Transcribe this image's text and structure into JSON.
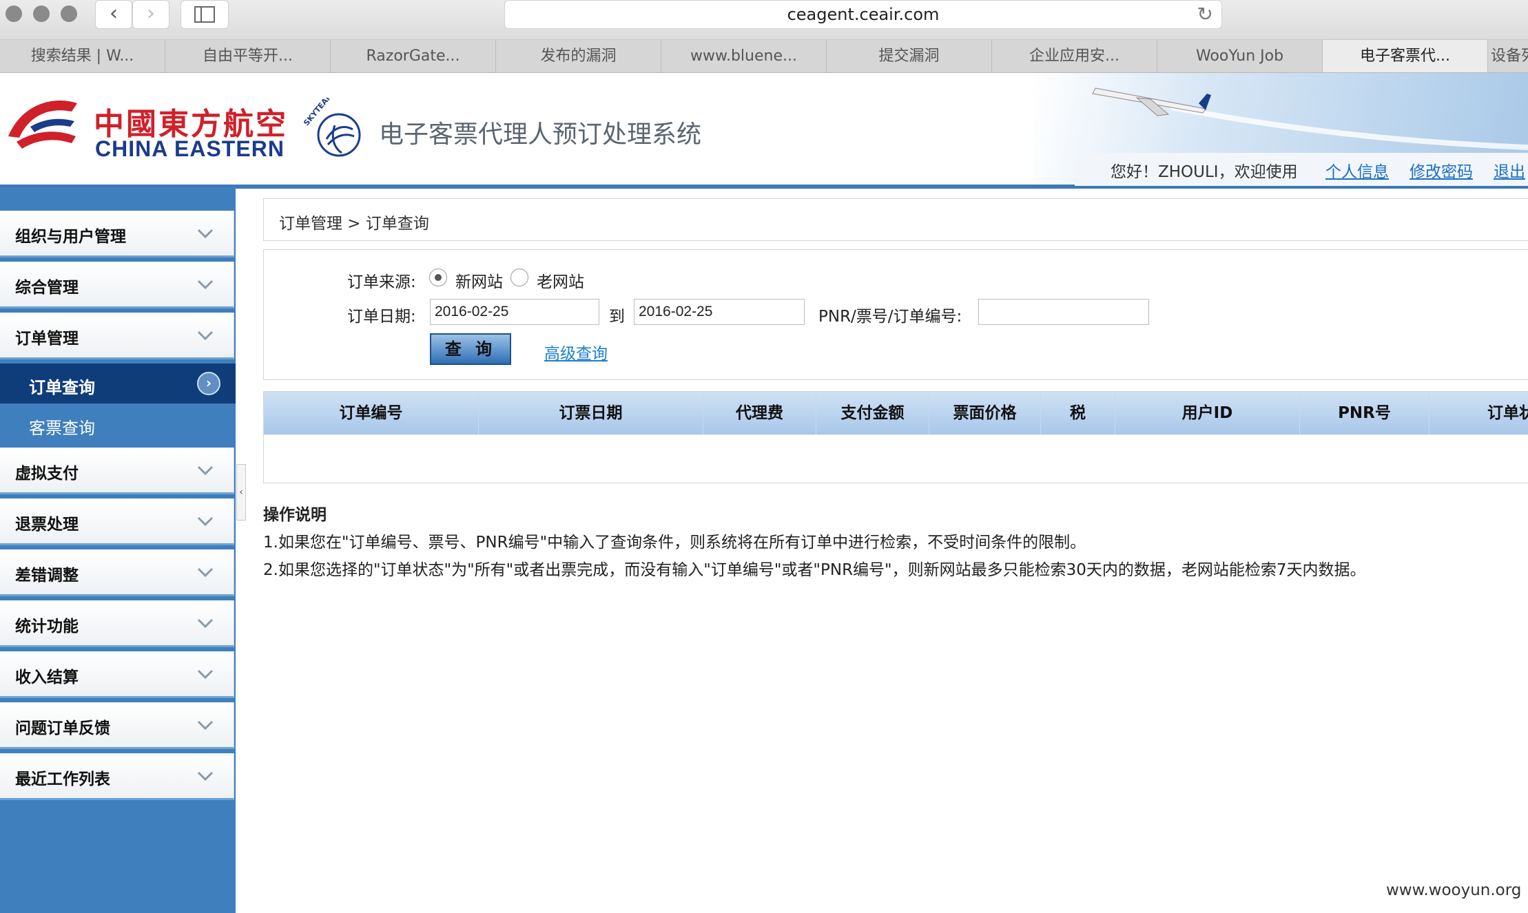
{
  "browser": {
    "url": "ceagent.ceair.com",
    "tabs": [
      "搜索结果 | W...",
      "自由平等开...",
      "RazorGate...",
      "发布的漏洞",
      "www.bluene...",
      "提交漏洞",
      "企业应用安...",
      "WooYun Job",
      "电子客票代...",
      "设备列表"
    ],
    "active_tab": 8
  },
  "header": {
    "brand_cn": "中國東方航空",
    "brand_en": "CHINA EASTERN",
    "skyteam": "SKYTEAM",
    "system_title": "电子客票代理人预订处理系统",
    "welcome": "您好！ZHOULI，欢迎使用",
    "links": {
      "profile": "个人信息",
      "change_password": "修改密码",
      "logout": "退出"
    }
  },
  "sidebar": {
    "items": [
      {
        "label": "组织与用户管理"
      },
      {
        "label": "综合管理"
      },
      {
        "label": "订单管理"
      },
      {
        "label": "虚拟支付"
      },
      {
        "label": "退票处理"
      },
      {
        "label": "差错调整"
      },
      {
        "label": "统计功能"
      },
      {
        "label": "收入结算"
      },
      {
        "label": "问题订单反馈"
      },
      {
        "label": "最近工作列表"
      }
    ],
    "subitems": [
      {
        "label": "订单查询",
        "active": true
      },
      {
        "label": "客票查询",
        "active": false
      }
    ]
  },
  "breadcrumb": "订单管理 > 订单查询",
  "form": {
    "source_label": "订单来源:",
    "source_options": [
      "新网站",
      "老网站"
    ],
    "source_selected": "新网站",
    "date_label": "订单日期:",
    "date_from": "2016-02-25",
    "date_to_label": "到",
    "date_to": "2016-02-25",
    "pnr_label": "PNR/票号/订单编号:",
    "pnr_value": "",
    "search_button": "查 询",
    "advanced_link": "高级查询"
  },
  "table": {
    "columns": [
      "订单编号",
      "订票日期",
      "代理费",
      "支付金额",
      "票面价格",
      "税",
      "用户ID",
      "PNR号",
      "订单状"
    ],
    "rows": []
  },
  "notes": {
    "title": "操作说明",
    "lines": [
      "1.如果您在\"订单编号、票号、PNR编号\"中输入了查询条件，则系统将在所有订单中进行检索，不受时间条件的限制。",
      "2.如果您选择的\"订单状态\"为\"所有\"或者出票完成，而没有输入\"订单编号\"或者\"PNR编号\"，则新网站最多只能检索30天内的数据，老网站能检索7天内数据。"
    ]
  },
  "watermark": "www.wooyun.org",
  "colors": {
    "brand_red": "#d0202a",
    "brand_blue": "#1a3c8c",
    "sidebar_blue": "#3f7fbd",
    "active_menu": "#0f3d7a",
    "link": "#1a6fc9"
  }
}
